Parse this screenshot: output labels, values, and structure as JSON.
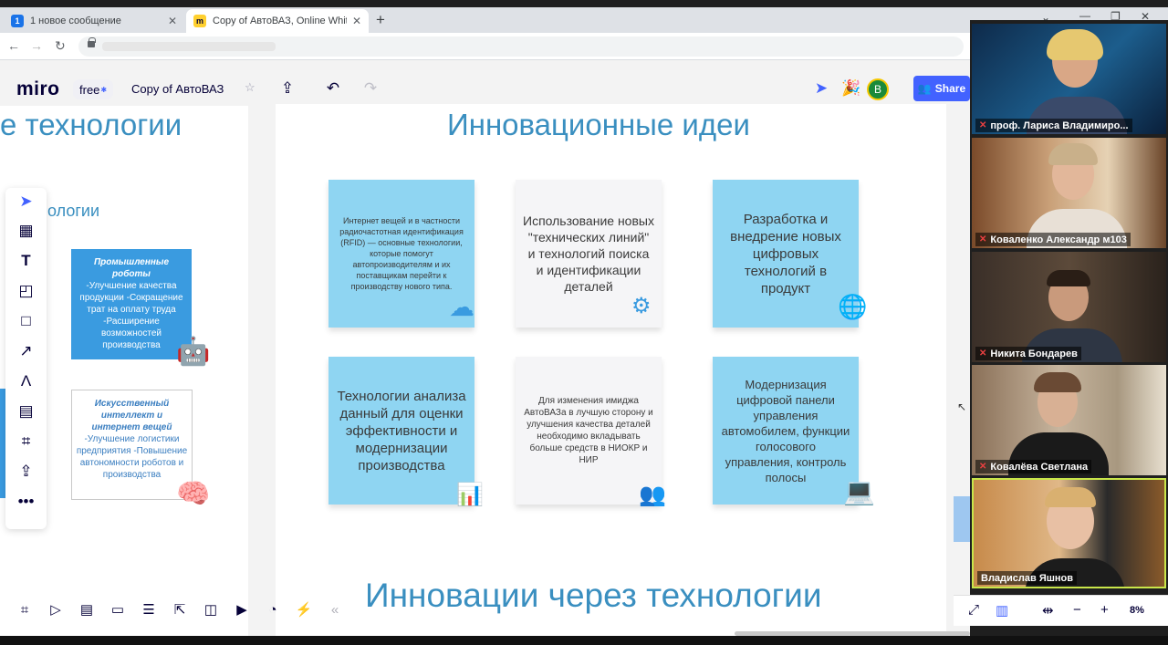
{
  "browser": {
    "tabs": [
      {
        "title": "1 новое сообщение",
        "favicon": "telemost-icon",
        "badge": "1"
      },
      {
        "title": "Copy of АвтоВАЗ, Online Whiteb",
        "favicon": "miro-icon"
      }
    ]
  },
  "miro": {
    "logo": "miro",
    "plan": "free",
    "board_name": "Copy of АвтоВАЗ",
    "avatar_initial": "B",
    "share_label": "Share",
    "accent": "#4262ff"
  },
  "board": {
    "heading_left": "е технологии",
    "subheading_left": "ологии",
    "heading_center": "Инновационные идеи",
    "heading_bottom": "Инновации через технологии",
    "left_cards": [
      {
        "title": "Промышленные роботы",
        "lines": "-Улучшение качества продукции -Сокращение трат на оплату труда -Расширение возможностей производства"
      },
      {
        "title": "Искусственный интеллект и интернет вещей",
        "lines": "-Улучшение логистики предприятия -Повышение автономности роботов и производства"
      }
    ],
    "stickies": [
      {
        "text": "Интернет вещей и в частности радиочастотная идентификация (RFID) — основные технологии, которые помогут автопроизводителям и их поставщикам перейти к производству нового типа."
      },
      {
        "text": "Использование новых \"технических линий\" и технологий поиска и идентификации деталей"
      },
      {
        "text": "Разработка и внедрение новых цифровых технологий в продукт"
      },
      {
        "text": "Технологии анализа данный для оценки эффективности и модернизации производства"
      },
      {
        "text": "Для изменения имиджа АвтоВАЗа в лучшую сторону и улучшения качества деталей необходимо вкладывать больше средств в НИОКР и НИР"
      },
      {
        "text": "Модернизация цифровой панели управления автомобилем, функции голосового управления, контроль полосы"
      }
    ],
    "colors": {
      "heading": "#3a8fc0",
      "sticky_blue": "#8fd5f2",
      "card_blue": "#3a9be0"
    }
  },
  "participants": [
    {
      "name": "проф. Лариса Владимиро..."
    },
    {
      "name": "Коваленко Александр м103"
    },
    {
      "name": "Никита Бондарев"
    },
    {
      "name": "Ковалёва Светлана"
    },
    {
      "name": "Владислав Яшнов"
    }
  ],
  "zoom": {
    "value": "8%"
  }
}
